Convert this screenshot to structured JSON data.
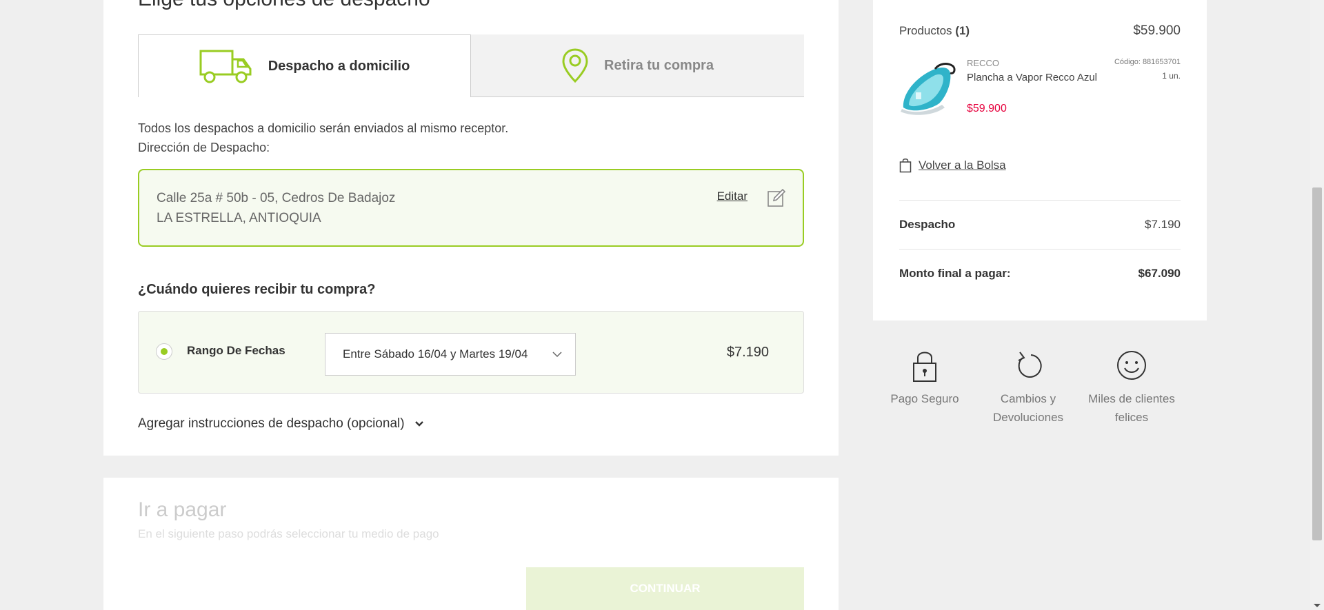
{
  "delivery": {
    "section_title": "Elige tus opciones de despacho",
    "tabs": [
      {
        "label": "Despacho a domicilio",
        "icon": "truck-icon",
        "active": true
      },
      {
        "label": "Retira tu compra",
        "icon": "map-pin-icon",
        "active": false
      }
    ],
    "note": "Todos los despachos a domicilio serán enviados al mismo receptor.",
    "address_heading": "Dirección de Despacho:",
    "address": {
      "line1": "Calle 25a # 50b - 05, Cedros De Badajoz",
      "line2": "LA ESTRELLA, ANTIOQUIA",
      "edit_label": "Editar"
    },
    "question": "¿Cuándo quieres recibir tu compra?",
    "option": {
      "label": "Rango De Fechas",
      "selected_range": "Entre Sábado 16/04 y Martes 19/04",
      "price": "$7.190"
    },
    "instructions_label": "Agregar instrucciones de despacho (opcional)"
  },
  "payment": {
    "title": "Ir a pagar",
    "subtitle": "En el siguiente paso podrás seleccionar tu medio de pago",
    "continue_label": "CONTINUAR"
  },
  "summary": {
    "products_label": "Productos",
    "products_count": "(1)",
    "products_total": "$59.900",
    "product": {
      "brand": "RECCO",
      "name": "Plancha a Vapor Recco Azul",
      "price": "$59.900",
      "code": "Código: 881653701",
      "qty": "1 un."
    },
    "back_label": "Volver a la Bolsa",
    "shipping_label": "Despacho",
    "shipping_value": "$7.190",
    "total_label": "Monto final a pagar:",
    "total_value": "$67.090"
  },
  "badges": [
    {
      "label": "Pago Seguro",
      "icon": "lock-icon"
    },
    {
      "label": "Cambios y Devoluciones",
      "icon": "refresh-icon"
    },
    {
      "label": "Miles de clientes felices",
      "icon": "smiley-icon"
    }
  ],
  "colors": {
    "accent": "#99cc22",
    "sale_price": "#e6003c"
  }
}
